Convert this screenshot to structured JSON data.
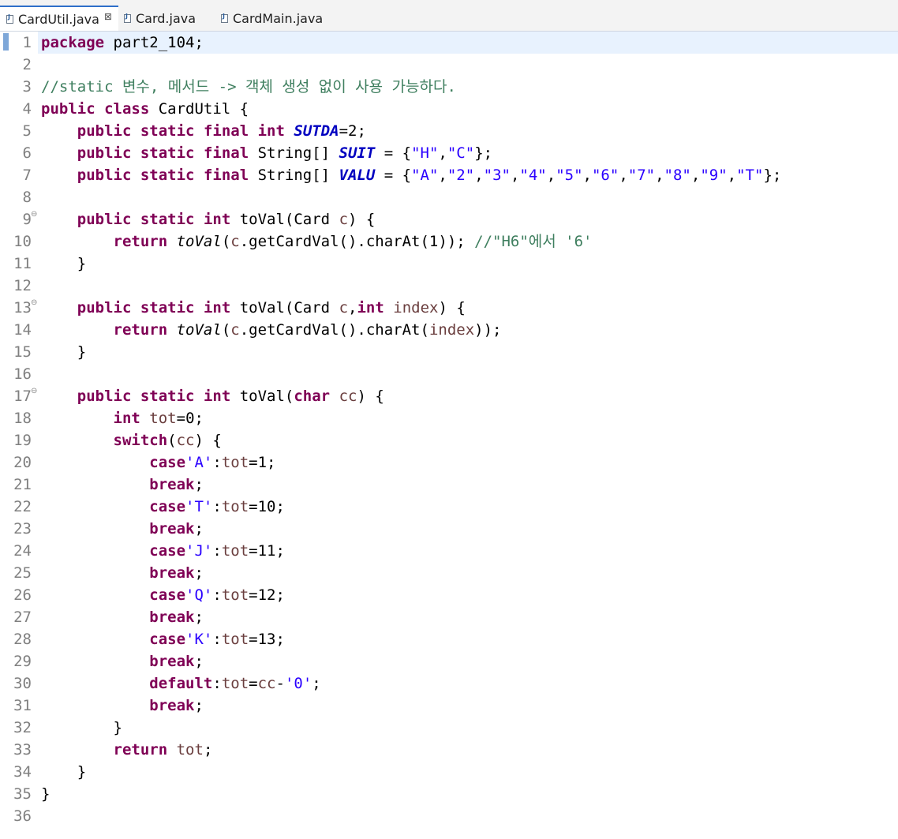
{
  "tabs": [
    {
      "label": "CardUtil.java",
      "close": "⊠"
    },
    {
      "label": "Card.java"
    },
    {
      "label": "CardMain.java"
    }
  ],
  "line_numbers": [
    "1",
    "2",
    "3",
    "4",
    "5",
    "6",
    "7",
    "8",
    "9",
    "10",
    "11",
    "12",
    "13",
    "14",
    "15",
    "16",
    "17",
    "18",
    "19",
    "20",
    "21",
    "22",
    "23",
    "24",
    "25",
    "26",
    "27",
    "28",
    "29",
    "30",
    "31",
    "32",
    "33",
    "34",
    "35",
    "36"
  ],
  "fold_marker": "⊖",
  "code": {
    "l1": [
      "package",
      " part2_104;"
    ],
    "l3": [
      "//static 변수, 메서드 -> 객체 생성 없이 사용 가능하다."
    ],
    "l4": [
      "public",
      " ",
      "class",
      " CardUtil {"
    ],
    "l5": [
      "    ",
      "public",
      " ",
      "static",
      " ",
      "final",
      " ",
      "int",
      " ",
      "SUTDA",
      "=2;"
    ],
    "l6": [
      "    ",
      "public",
      " ",
      "static",
      " ",
      "final",
      " String[] ",
      "SUIT",
      " = {",
      "\"H\"",
      ",",
      "\"C\"",
      "};"
    ],
    "l7": [
      "    ",
      "public",
      " ",
      "static",
      " ",
      "final",
      " String[] ",
      "VALU",
      " = {",
      "\"A\"",
      ",",
      "\"2\"",
      ",",
      "\"3\"",
      ",",
      "\"4\"",
      ",",
      "\"5\"",
      ",",
      "\"6\"",
      ",",
      "\"7\"",
      ",",
      "\"8\"",
      ",",
      "\"9\"",
      ",",
      "\"T\"",
      "};"
    ],
    "l9": [
      "    ",
      "public",
      " ",
      "static",
      " ",
      "int",
      " toVal(Card ",
      "c",
      ") {"
    ],
    "l10": [
      "        ",
      "return",
      " ",
      "toVal",
      "(",
      "c",
      ".getCardVal().charAt(1)); ",
      "//\"H6\"에서 '6'"
    ],
    "l11": [
      "    }"
    ],
    "l13": [
      "    ",
      "public",
      " ",
      "static",
      " ",
      "int",
      " toVal(Card ",
      "c",
      ",",
      "int",
      " ",
      "index",
      ") {"
    ],
    "l14": [
      "        ",
      "return",
      " ",
      "toVal",
      "(",
      "c",
      ".getCardVal().charAt(",
      "index",
      "));"
    ],
    "l15": [
      "    }"
    ],
    "l17": [
      "    ",
      "public",
      " ",
      "static",
      " ",
      "int",
      " toVal(",
      "char",
      " ",
      "cc",
      ") {"
    ],
    "l18": [
      "        ",
      "int",
      " ",
      "tot",
      "=0;"
    ],
    "l19": [
      "        ",
      "switch",
      "(",
      "cc",
      ") {"
    ],
    "l20": [
      "            ",
      "case",
      "'A'",
      ":",
      "tot",
      "=1;"
    ],
    "l21": [
      "            ",
      "break",
      ";"
    ],
    "l22": [
      "            ",
      "case",
      "'T'",
      ":",
      "tot",
      "=10;"
    ],
    "l23": [
      "            ",
      "break",
      ";"
    ],
    "l24": [
      "            ",
      "case",
      "'J'",
      ":",
      "tot",
      "=11;"
    ],
    "l25": [
      "            ",
      "break",
      ";"
    ],
    "l26": [
      "            ",
      "case",
      "'Q'",
      ":",
      "tot",
      "=12;"
    ],
    "l27": [
      "            ",
      "break",
      ";"
    ],
    "l28": [
      "            ",
      "case",
      "'K'",
      ":",
      "tot",
      "=13;"
    ],
    "l29": [
      "            ",
      "break",
      ";"
    ],
    "l30": [
      "            ",
      "default",
      ":",
      "tot",
      "=",
      "cc",
      "-",
      "'0'",
      ";"
    ],
    "l31": [
      "            ",
      "break",
      ";"
    ],
    "l32": [
      "        }"
    ],
    "l33": [
      "        ",
      "return",
      " ",
      "tot",
      ";"
    ],
    "l34": [
      "    }"
    ],
    "l35": [
      "}"
    ]
  }
}
